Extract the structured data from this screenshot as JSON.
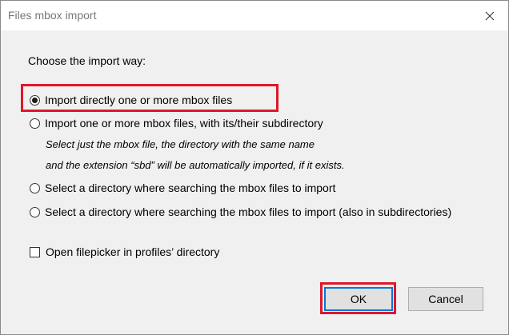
{
  "window": {
    "title": "Files mbox import"
  },
  "prompt": "Choose the import way:",
  "options": [
    {
      "label": "Import directly one or more mbox files",
      "selected": true
    },
    {
      "label": "Import one or more mbox files, with its/their subdirectory",
      "selected": false
    },
    {
      "label": "Select a directory where searching the mbox files to import",
      "selected": false
    },
    {
      "label": "Select a directory where searching the mbox files to import (also in subdirectories)",
      "selected": false
    }
  ],
  "subdirectory_note": {
    "line1": "Select just the mbox file, the directory with the same name",
    "line2": "and the extension “sbd” will be automatically imported, if it exists."
  },
  "checkbox": {
    "label": "Open filepicker in profiles’ directory",
    "checked": false
  },
  "buttons": {
    "ok": "OK",
    "cancel": "Cancel"
  },
  "colors": {
    "highlight": "#e0162b",
    "focus_border": "#0078d7",
    "dialog_background": "#f0f0f0"
  },
  "icons": {
    "close": "close-icon"
  }
}
